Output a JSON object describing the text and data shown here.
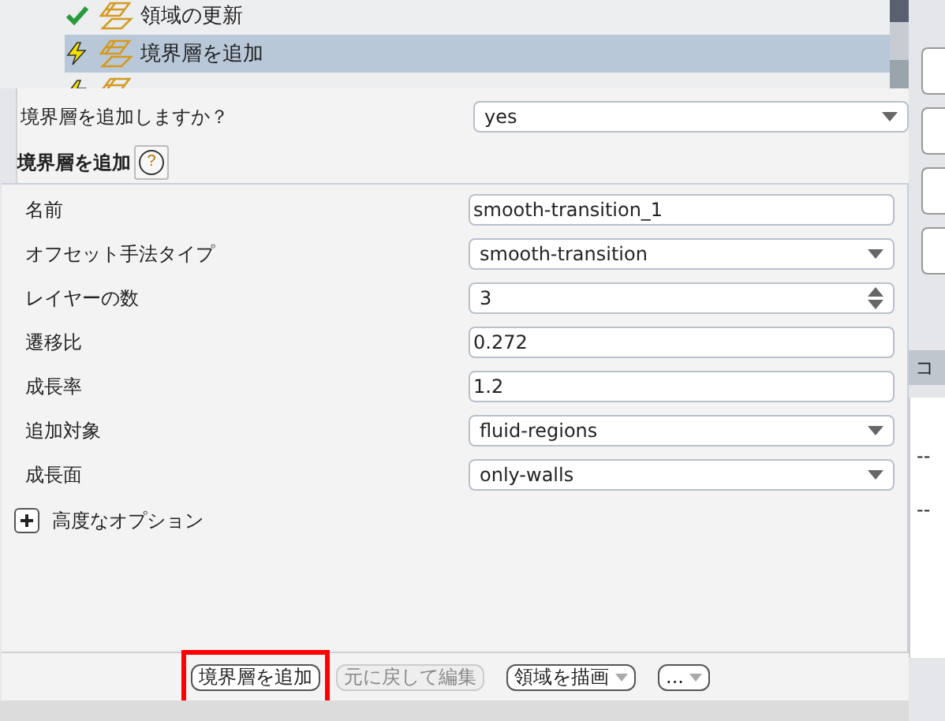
{
  "tree": {
    "items": [
      {
        "label": "領域の更新",
        "kind": "ok",
        "selected": false
      },
      {
        "label": "境界層を追加",
        "kind": "warning",
        "selected": true
      },
      {
        "kind": "warning",
        "selected": false
      }
    ]
  },
  "question": {
    "label": "境界層を追加しますか？",
    "value": "yes"
  },
  "section": {
    "title": "境界層を追加",
    "help": "?"
  },
  "fields": [
    {
      "label": "名前",
      "kind": "text",
      "value": "smooth-transition_1"
    },
    {
      "label": "オフセット手法タイプ",
      "kind": "dropdown",
      "value": "smooth-transition"
    },
    {
      "label": "レイヤーの数",
      "kind": "spinner",
      "value": "3"
    },
    {
      "label": "遷移比",
      "kind": "text",
      "value": "0.272"
    },
    {
      "label": "成長率",
      "kind": "text",
      "value": "1.2"
    },
    {
      "label": "追加対象",
      "kind": "dropdown",
      "value": "fluid-regions"
    },
    {
      "label": "成長面",
      "kind": "dropdown",
      "value": "only-walls"
    }
  ],
  "advanced": {
    "label": "高度なオプション",
    "expanded": false
  },
  "buttons": [
    {
      "label": "境界層を追加",
      "kind": "button",
      "disabled": false,
      "highlighted": true
    },
    {
      "label": "元に戻して編集",
      "kind": "button",
      "disabled": true,
      "highlighted": false
    },
    {
      "label": "領域を描画",
      "kind": "menu",
      "disabled": false,
      "highlighted": false
    },
    {
      "label": "...",
      "kind": "menu",
      "disabled": false,
      "highlighted": false
    }
  ],
  "right_panel": {
    "tab_label": "コ",
    "values": [
      "--",
      "--"
    ]
  }
}
